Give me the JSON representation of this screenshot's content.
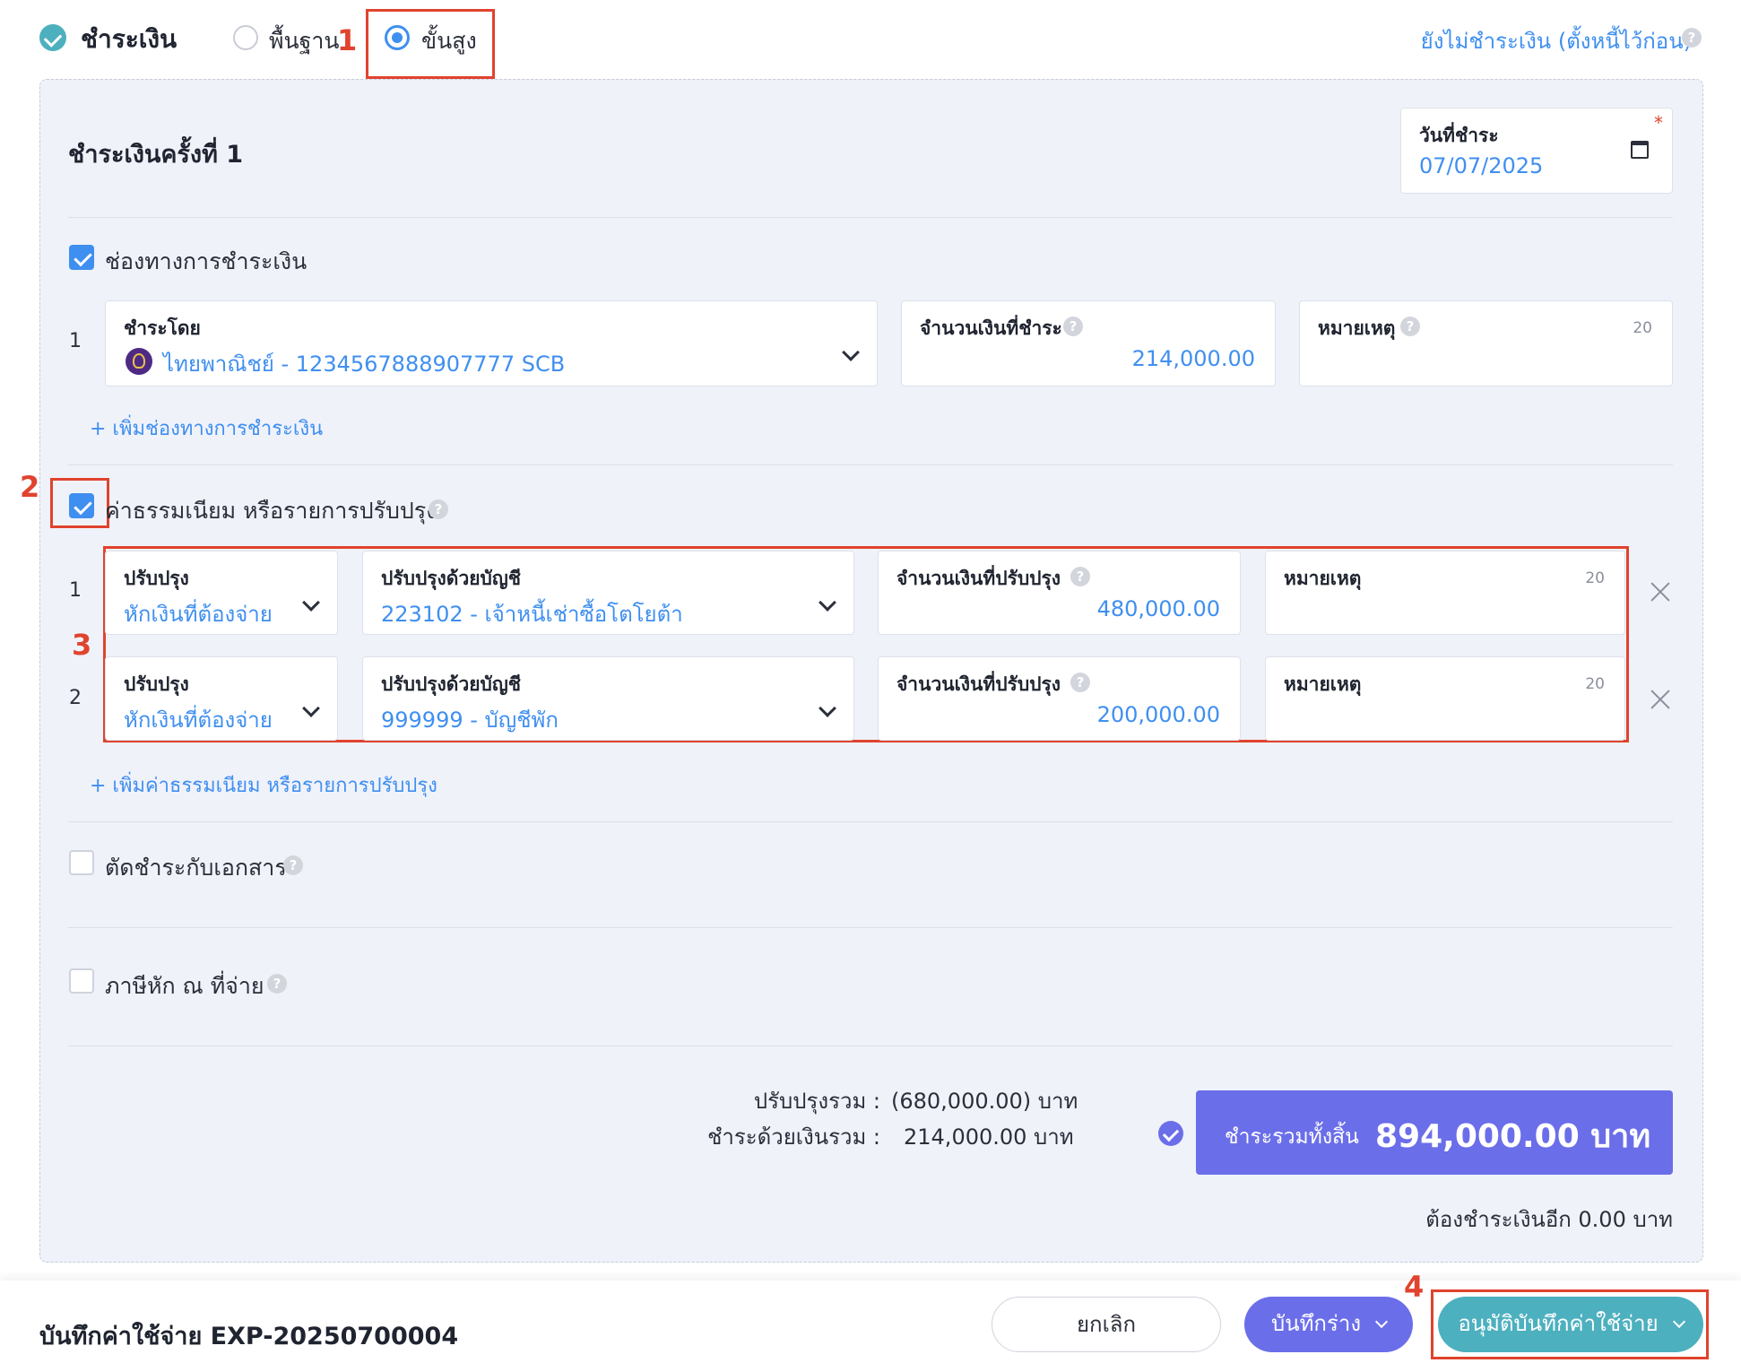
{
  "header": {
    "title": "ชำระเงิน",
    "mode_basic": "พื้นฐาน",
    "mode_advanced": "ขั้นสูง",
    "unpaid_link": "ยังไม่ชำระเงิน (ตั้งหนี้ไว้ก่อน)"
  },
  "payment_round": {
    "title": "ชำระเงินครั้งที่ 1",
    "date_label": "วันที่ชำระ",
    "date_value": "07/07/2025",
    "required_mark": "*"
  },
  "channels": {
    "label": "ช่องทางการชำระเงิน",
    "rows": [
      {
        "num": "1",
        "pay_by_label": "ชำระโดย",
        "pay_by_value": "ไทยพาณิชย์ - 1234567888907777 SCB",
        "amount_label": "จำนวนเงินที่ชำระ",
        "amount_value": "214,000.00",
        "note_label": "หมายเหตุ",
        "note_counter": "20"
      }
    ],
    "add_label": "+ เพิ่มช่องทางการชำระเงิน"
  },
  "adjustments": {
    "label": "ค่าธรรมเนียม หรือรายการปรับปรุง",
    "rows": [
      {
        "num": "1",
        "type_label": "ปรับปรุง",
        "type_value": "หักเงินที่ต้องจ่าย",
        "account_label": "ปรับปรุงด้วยบัญชี",
        "account_value": "223102 - เจ้าหนี้เช่าซื้อโตโยต้า",
        "amount_label": "จำนวนเงินที่ปรับปรุง",
        "amount_value": "480,000.00",
        "note_label": "หมายเหตุ",
        "note_counter": "20"
      },
      {
        "num": "2",
        "type_label": "ปรับปรุง",
        "type_value": "หักเงินที่ต้องจ่าย",
        "account_label": "ปรับปรุงด้วยบัญชี",
        "account_value": "999999 - บัญชีพัก",
        "amount_label": "จำนวนเงินที่ปรับปรุง",
        "amount_value": "200,000.00",
        "note_label": "หมายเหตุ",
        "note_counter": "20"
      }
    ],
    "add_label": "+ เพิ่มค่าธรรมเนียม หรือรายการปรับปรุง"
  },
  "offset_docs": {
    "label": "ตัดชำระกับเอกสาร"
  },
  "withholding": {
    "label": "ภาษีหัก ณ ที่จ่าย"
  },
  "summary": {
    "adjust_total_label": "ปรับปรุงรวม :",
    "adjust_total_value": "(680,000.00) บาท",
    "cash_total_label": "ชำระด้วยเงินรวม :",
    "cash_total_value": "214,000.00 บาท",
    "grand_label": "ชำระรวมทั้งสิ้น",
    "grand_value": "894,000.00 บาท",
    "remaining": "ต้องชำระเงินอีก 0.00 บาท"
  },
  "footer": {
    "doc_title": "บันทึกค่าใช้จ่าย EXP-20250700004",
    "cancel": "ยกเลิก",
    "draft": "บันทึกร่าง",
    "approve": "อนุมัติบันทึกค่าใช้จ่าย"
  },
  "annotations": {
    "n1": "1",
    "n2": "2",
    "n3": "3",
    "n4": "4"
  },
  "colors": {
    "accent": "#3f8ff0",
    "primary": "#6b6ee9",
    "teal": "#4db0bf",
    "annotation": "#e0432e"
  }
}
